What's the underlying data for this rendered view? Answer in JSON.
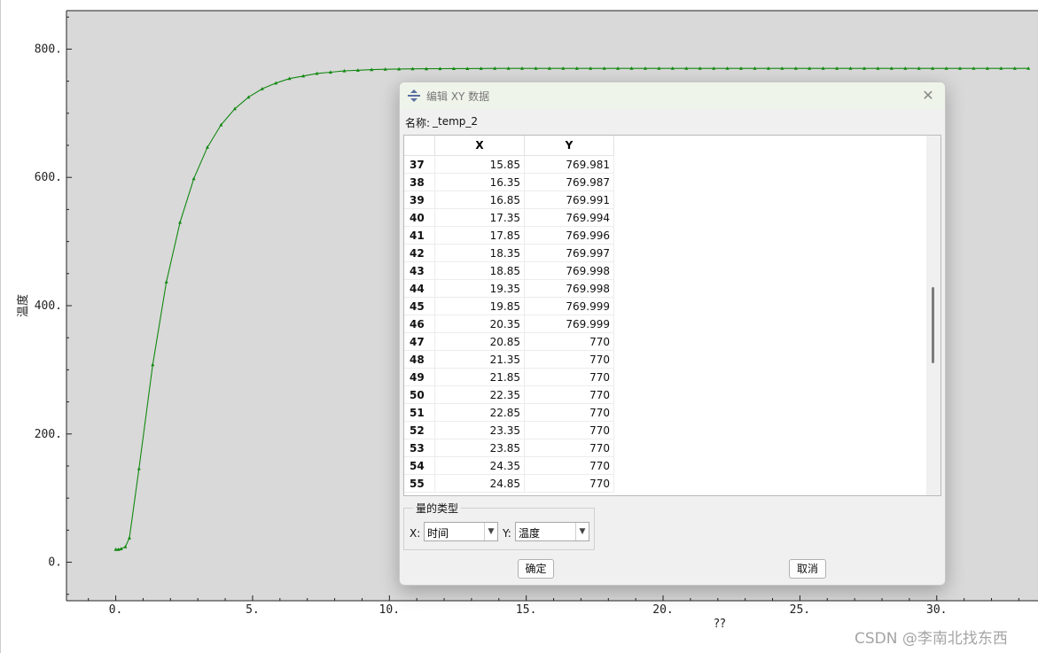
{
  "chart_data": {
    "type": "line",
    "title": "",
    "xlabel": "??",
    "ylabel": "温度",
    "xlim": [
      -1.8,
      33.7
    ],
    "ylim": [
      -60,
      860
    ],
    "xticks": [
      "0.",
      "5.",
      "10.",
      "15.",
      "20.",
      "25.",
      "30."
    ],
    "xtick_values": [
      0,
      5,
      10,
      15,
      20,
      25,
      30
    ],
    "yticks": [
      "0.",
      "200.",
      "400.",
      "600.",
      "800."
    ],
    "ytick_values": [
      0,
      200,
      400,
      600,
      800
    ],
    "grid": false,
    "colors": {
      "line": "#118811",
      "background": "#d9d9d9"
    },
    "series": [
      {
        "x": [
          0,
          0.1,
          0.2,
          0.35,
          0.5,
          0.85,
          1.35,
          1.85,
          2.35,
          2.85,
          3.35,
          3.85,
          4.35,
          4.85,
          5.35,
          5.85,
          6.35,
          6.85,
          7.35,
          7.85,
          8.35,
          8.85,
          9.35,
          9.85,
          10.35,
          10.85,
          11.35,
          11.85,
          12.35,
          12.85,
          13.35,
          13.85,
          14.35,
          14.85,
          15.35,
          15.85,
          16.35,
          16.85,
          17.35,
          17.85,
          18.35,
          18.85,
          19.35,
          19.85,
          20.35,
          20.85,
          21.35,
          21.85,
          22.35,
          22.85,
          23.35,
          23.85,
          24.35,
          24.85,
          25.35,
          25.85,
          26.35,
          26.85,
          27.35,
          27.85,
          28.35,
          28.85,
          29.35,
          29.85,
          30.35,
          30.85,
          31.35,
          31.85,
          32.35,
          32.85,
          33.35
        ],
        "y": [
          20,
          20,
          21,
          24,
          38,
          146,
          308,
          437,
          530,
          598,
          647,
          682,
          707,
          725,
          738,
          747,
          754,
          758,
          762,
          764,
          766,
          767,
          768,
          768.5,
          769,
          769.2,
          769.4,
          769.5,
          769.6,
          769.7,
          769.8,
          769.9,
          769.95,
          769.97,
          769.975,
          769.981,
          769.987,
          769.991,
          769.994,
          769.996,
          769.997,
          769.998,
          769.998,
          769.999,
          769.999,
          770,
          770,
          770,
          770,
          770,
          770,
          770,
          770,
          770,
          770,
          770,
          770,
          770,
          770,
          770,
          770,
          770,
          770,
          770,
          770,
          770,
          770,
          770,
          770,
          770,
          770
        ]
      }
    ]
  },
  "dialog": {
    "title": "编辑 XY 数据",
    "close_icon": "✕",
    "name_label": "名称:",
    "name_value": "_temp_2",
    "table": {
      "columns": [
        "X",
        "Y"
      ],
      "rows": [
        {
          "n": "37",
          "x": "15.85",
          "y": "769.981"
        },
        {
          "n": "38",
          "x": "16.35",
          "y": "769.987"
        },
        {
          "n": "39",
          "x": "16.85",
          "y": "769.991"
        },
        {
          "n": "40",
          "x": "17.35",
          "y": "769.994"
        },
        {
          "n": "41",
          "x": "17.85",
          "y": "769.996"
        },
        {
          "n": "42",
          "x": "18.35",
          "y": "769.997"
        },
        {
          "n": "43",
          "x": "18.85",
          "y": "769.998"
        },
        {
          "n": "44",
          "x": "19.35",
          "y": "769.998"
        },
        {
          "n": "45",
          "x": "19.85",
          "y": "769.999"
        },
        {
          "n": "46",
          "x": "20.35",
          "y": "769.999"
        },
        {
          "n": "47",
          "x": "20.85",
          "y": "770"
        },
        {
          "n": "48",
          "x": "21.35",
          "y": "770"
        },
        {
          "n": "49",
          "x": "21.85",
          "y": "770"
        },
        {
          "n": "50",
          "x": "22.35",
          "y": "770"
        },
        {
          "n": "51",
          "x": "22.85",
          "y": "770"
        },
        {
          "n": "52",
          "x": "23.35",
          "y": "770"
        },
        {
          "n": "53",
          "x": "23.85",
          "y": "770"
        },
        {
          "n": "54",
          "x": "24.35",
          "y": "770"
        },
        {
          "n": "55",
          "x": "24.85",
          "y": "770"
        }
      ]
    },
    "quantity_group": {
      "legend": "量的类型",
      "x_label": "X:",
      "x_value": "时间",
      "y_label": "Y:",
      "y_value": "温度"
    },
    "ok_label": "确定",
    "cancel_label": "取消"
  },
  "watermark": "CSDN @李南北找东西"
}
